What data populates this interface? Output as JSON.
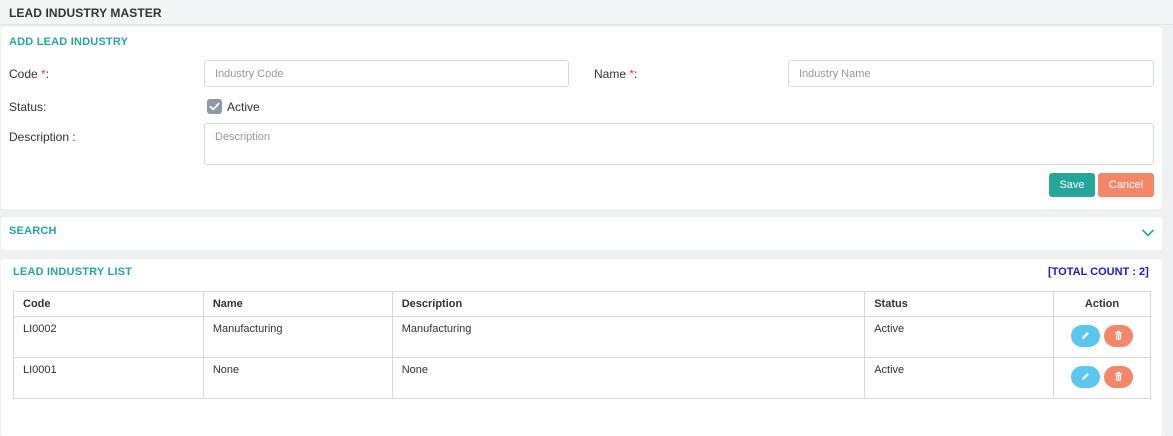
{
  "page": {
    "title": "LEAD INDUSTRY MASTER"
  },
  "add_form": {
    "title": "ADD LEAD INDUSTRY",
    "code_label": "Code",
    "name_label": "Name",
    "required_mark": "*",
    "colon": ":",
    "code_placeholder": "Industry Code",
    "name_placeholder": "Industry Name",
    "status_label": "Status:",
    "active_label": "Active",
    "active_checked": true,
    "description_label": "Description :",
    "description_placeholder": "Description",
    "save_label": "Save",
    "cancel_label": "Cancel"
  },
  "search": {
    "title": "SEARCH",
    "icon": "chevron-down-icon"
  },
  "list": {
    "title": "LEAD INDUSTRY LIST",
    "total_count": "[TOTAL COUNT : 2]",
    "columns": [
      "Code",
      "Name",
      "Description",
      "Status",
      "Action"
    ],
    "rows": [
      {
        "code": "LI0002",
        "name": "Manufacturing",
        "description": "Manufacturing",
        "status": "Active"
      },
      {
        "code": "LI0001",
        "name": "None",
        "description": "None",
        "status": "Active"
      }
    ]
  },
  "colors": {
    "accent": "#26a69a",
    "cancel": "#f4866a",
    "edit": "#5bc6ee",
    "count": "#1a1ad0",
    "required": "#e53935"
  }
}
